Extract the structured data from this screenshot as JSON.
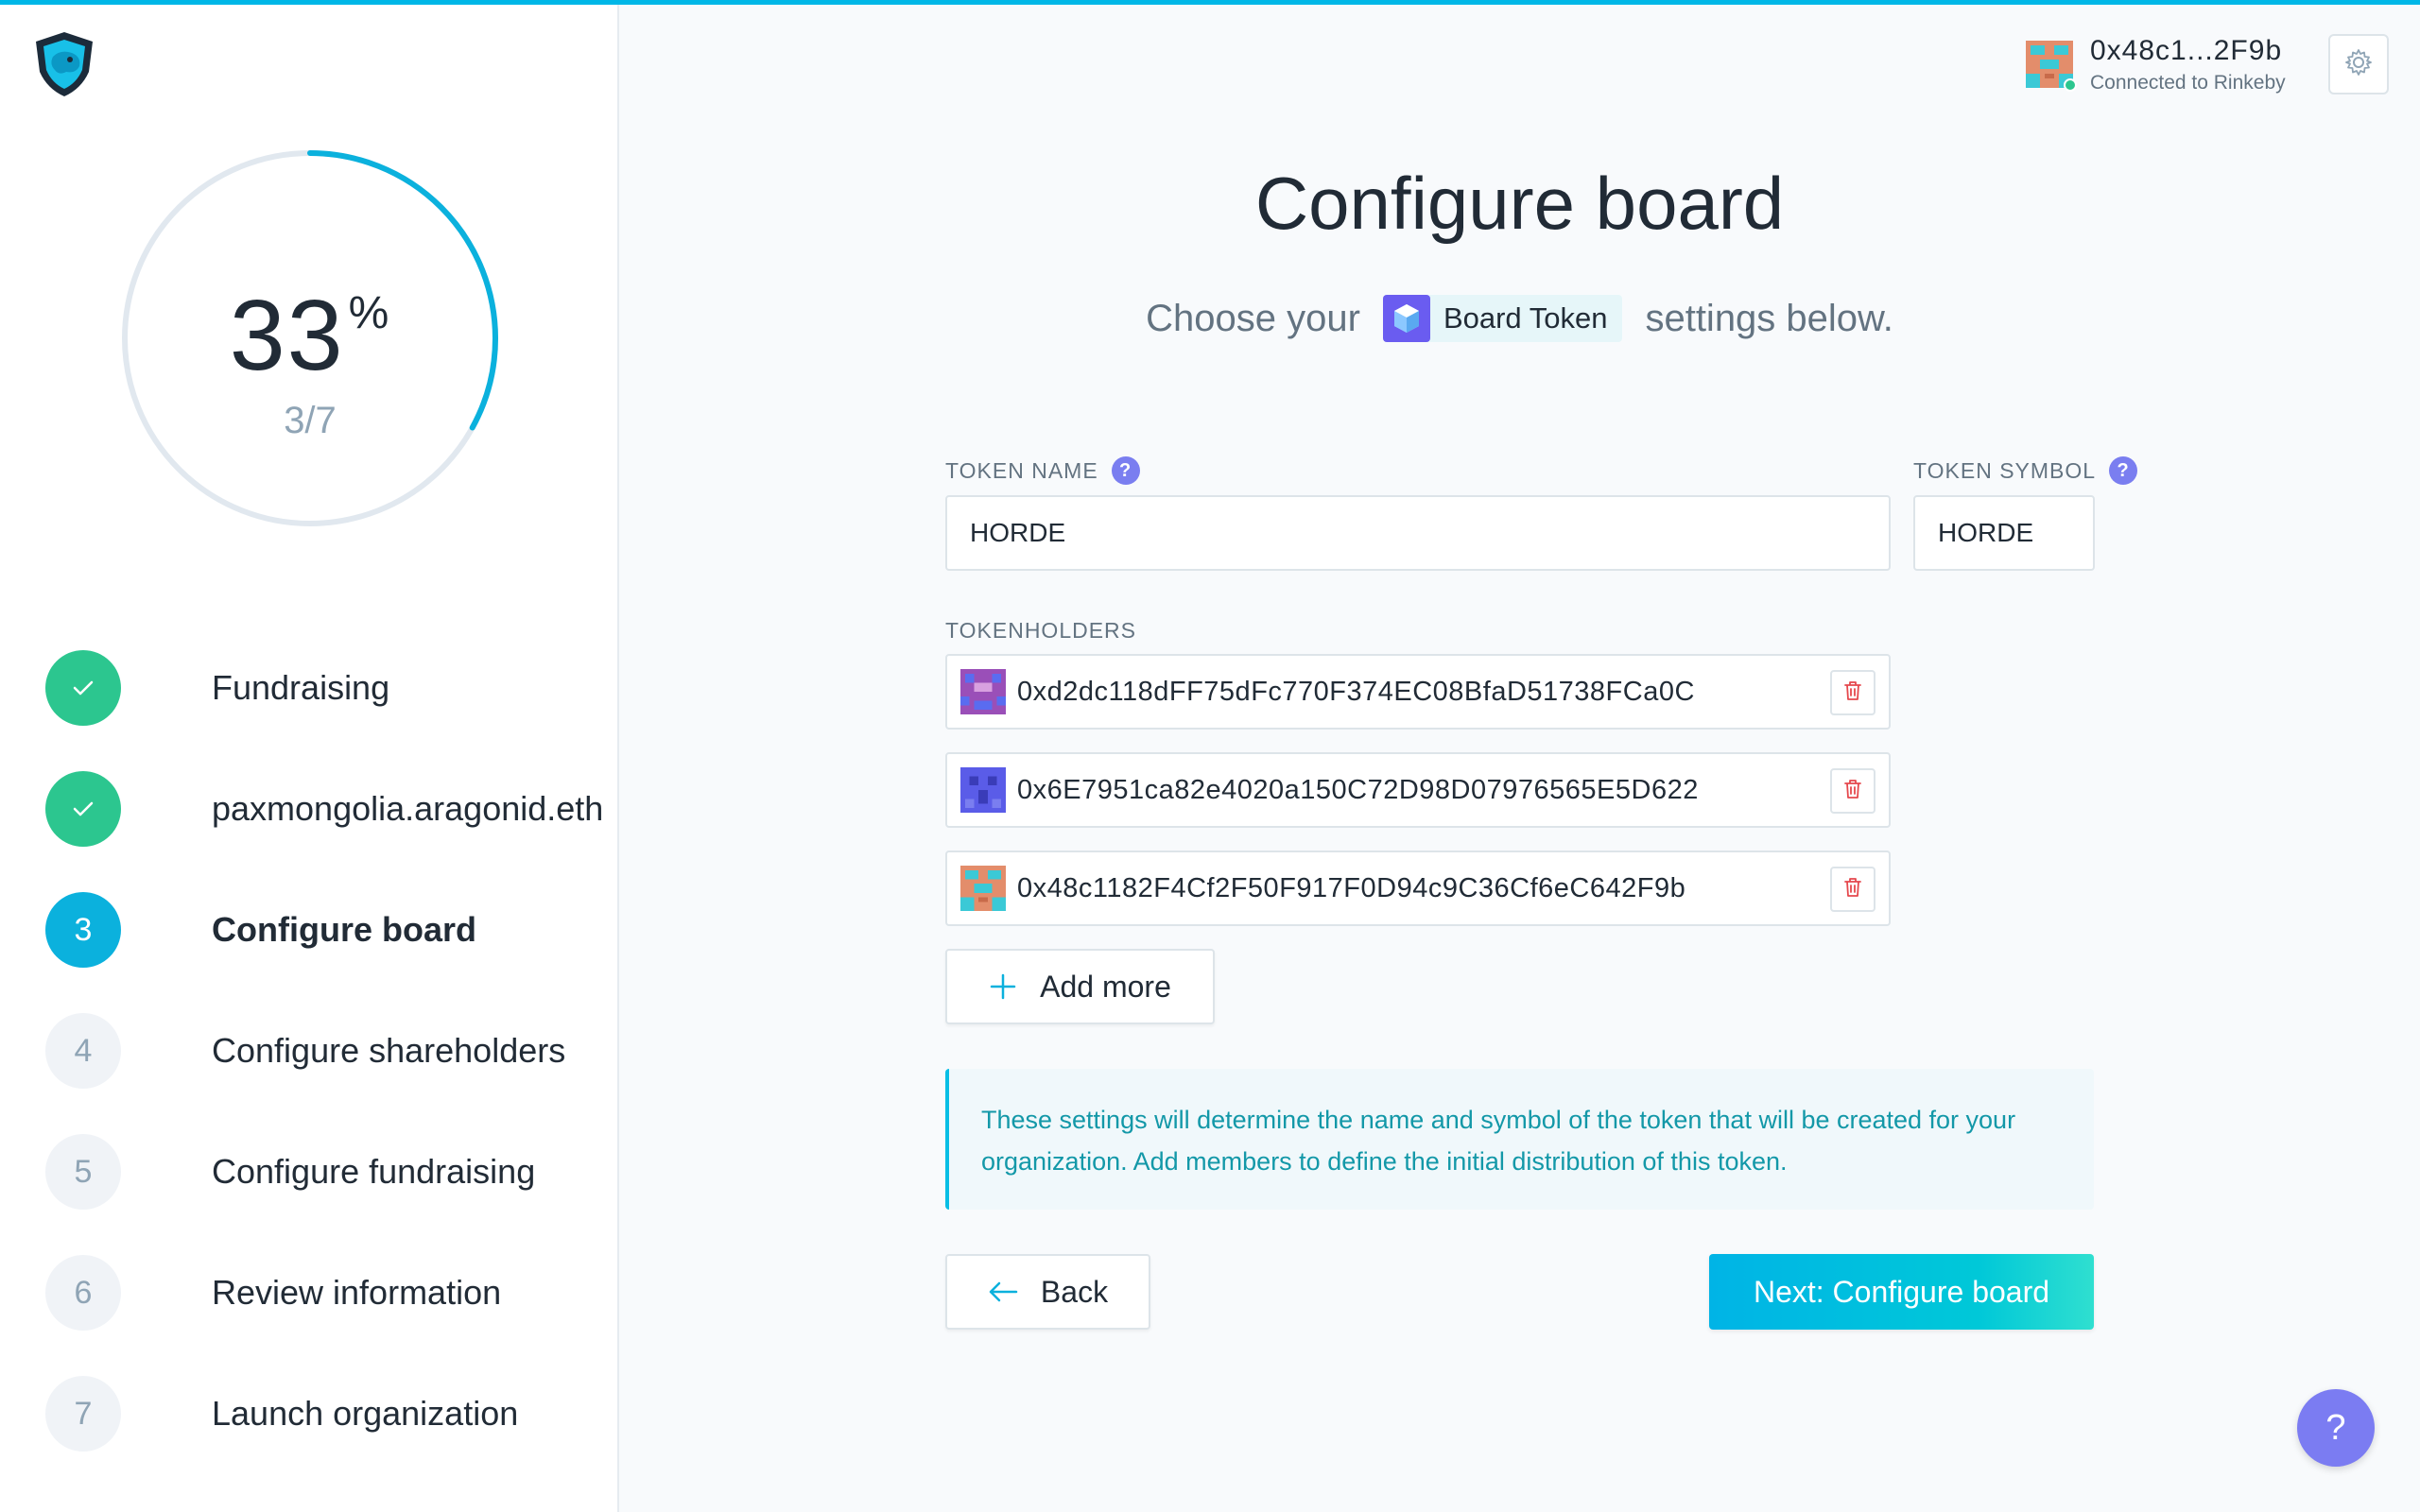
{
  "colors": {
    "accent": "#00b7e7",
    "success": "#2cc68f",
    "help": "#7b7cf2",
    "info_text": "#1398a8",
    "delete": "#e5484d"
  },
  "sidebar": {
    "progress": {
      "percent": "33",
      "percent_sign": "%",
      "fraction": "3/7",
      "value": 0.33
    },
    "steps": [
      {
        "number": "1",
        "label": "Fundraising",
        "state": "done"
      },
      {
        "number": "2",
        "label": "paxmongolia.aragonid.eth",
        "state": "done"
      },
      {
        "number": "3",
        "label": "Configure board",
        "state": "active"
      },
      {
        "number": "4",
        "label": "Configure shareholders",
        "state": "pending"
      },
      {
        "number": "5",
        "label": "Configure fundraising",
        "state": "pending"
      },
      {
        "number": "6",
        "label": "Review information",
        "state": "pending"
      },
      {
        "number": "7",
        "label": "Launch organization",
        "state": "pending"
      }
    ]
  },
  "header": {
    "account_address": "0x48c1...2F9b",
    "account_status": "Connected to Rinkeby",
    "settings_icon": "gear-icon"
  },
  "main": {
    "title": "Configure board",
    "subtitle_before": "Choose your",
    "app_badge": "Board Token",
    "subtitle_after": "settings below.",
    "token_name": {
      "label": "TOKEN NAME",
      "value": "HORDE"
    },
    "token_symbol": {
      "label": "TOKEN SYMBOL",
      "value": "HORDE"
    },
    "tokenholders_label": "TOKENHOLDERS",
    "tokenholders": [
      {
        "address": "0xd2dc118dFF75dFc770F374EC08BfaD51738FCa0C"
      },
      {
        "address": "0x6E7951ca82e4020a150C72D98D07976565E5D622"
      },
      {
        "address": "0x48c1182F4Cf2F50F917F0D94c9C36Cf6eC642F9b"
      }
    ],
    "add_more_label": "Add more",
    "info_text": "These settings will determine the name and symbol of the token that will be created for your organization. Add members to define the initial distribution of this token.",
    "back_label": "Back",
    "next_label": "Next: Configure board",
    "help_label": "?"
  }
}
